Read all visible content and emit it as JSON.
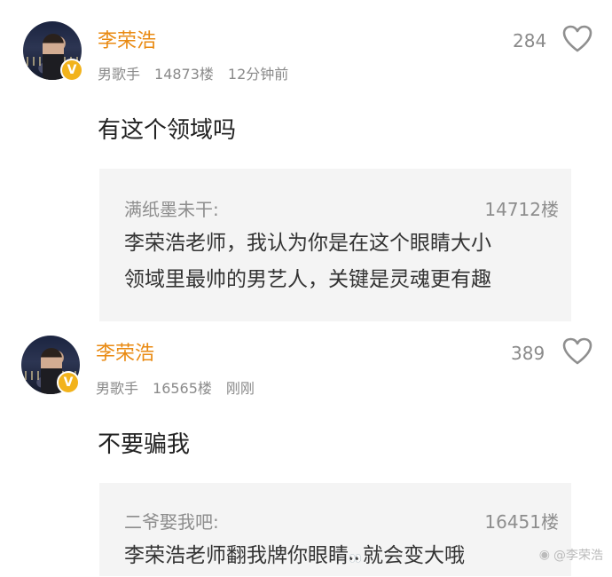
{
  "comments": [
    {
      "username": "李荣浩",
      "verified_badge": "V",
      "role": "男歌手",
      "floor": "14873楼",
      "time": "12分钟前",
      "likes": "284",
      "text": "有这个领域吗",
      "quote": {
        "author": "满纸墨未干:",
        "floor": "14712楼",
        "line1": "李荣浩老师，我认为你是在这个眼睛大小",
        "line2": "领域里最帅的男艺人，关键是灵魂更有趣"
      }
    },
    {
      "username": "李荣浩",
      "verified_badge": "V",
      "role": "男歌手",
      "floor": "16565楼",
      "time": "刚刚",
      "likes": "389",
      "text": "不要骗我",
      "quote": {
        "author": "二爷娶我吧:",
        "floor": "16451楼",
        "line1_a": "李荣浩老师翻我牌你眼睛",
        "line1_emoji": "👀",
        "line1_b": "就会变大哦"
      }
    }
  ],
  "watermark": "@李荣浩",
  "colors": {
    "username": "#e98a12",
    "badge": "#f2b31c",
    "quote_bg": "#f4f4f4",
    "meta": "#8a8a8a"
  },
  "icons": {
    "like": "heart-outline-icon",
    "verified": "verified-v-badge-icon"
  }
}
